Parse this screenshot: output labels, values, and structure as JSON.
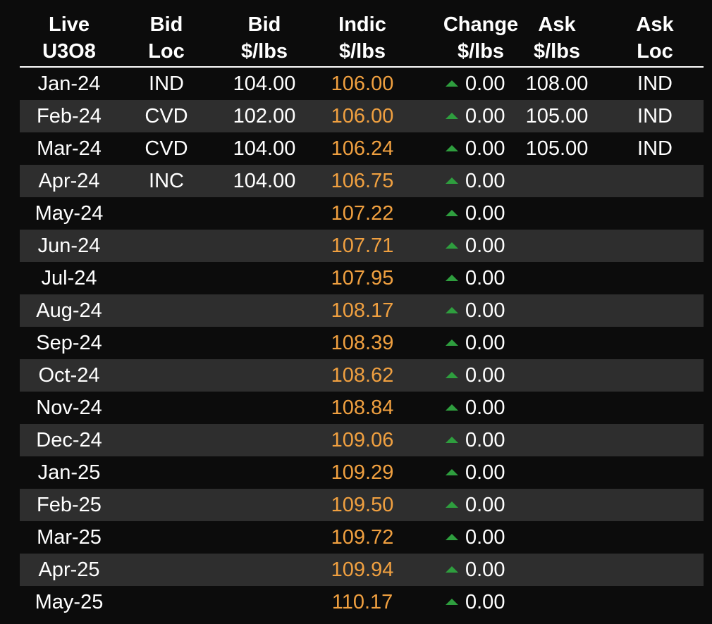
{
  "headers": [
    {
      "line1": "Live",
      "line2": "U3O8"
    },
    {
      "line1": "Bid",
      "line2": "Loc"
    },
    {
      "line1": "Bid",
      "line2": "$/lbs"
    },
    {
      "line1": "Indic",
      "line2": "$/lbs"
    },
    {
      "line1": "Change",
      "line2": "$/lbs"
    },
    {
      "line1": "Ask",
      "line2": "$/lbs"
    },
    {
      "line1": "Ask",
      "line2": "Loc"
    }
  ],
  "colors": {
    "background": "#0c0c0c",
    "row_alt": "#2e2e2e",
    "indic": "#f0a040",
    "up_arrow": "#2e9e3e",
    "text": "#ffffff"
  },
  "change_icon": "up-triangle-icon",
  "rows": [
    {
      "month": "Jan-24",
      "bid_loc": "IND",
      "bid": "104.00",
      "indic": "106.00",
      "change": "0.00",
      "ask": "108.00",
      "ask_loc": "IND"
    },
    {
      "month": "Feb-24",
      "bid_loc": "CVD",
      "bid": "102.00",
      "indic": "106.00",
      "change": "0.00",
      "ask": "105.00",
      "ask_loc": "IND"
    },
    {
      "month": "Mar-24",
      "bid_loc": "CVD",
      "bid": "104.00",
      "indic": "106.24",
      "change": "0.00",
      "ask": "105.00",
      "ask_loc": "IND"
    },
    {
      "month": "Apr-24",
      "bid_loc": "INC",
      "bid": "104.00",
      "indic": "106.75",
      "change": "0.00",
      "ask": "",
      "ask_loc": ""
    },
    {
      "month": "May-24",
      "bid_loc": "",
      "bid": "",
      "indic": "107.22",
      "change": "0.00",
      "ask": "",
      "ask_loc": ""
    },
    {
      "month": "Jun-24",
      "bid_loc": "",
      "bid": "",
      "indic": "107.71",
      "change": "0.00",
      "ask": "",
      "ask_loc": ""
    },
    {
      "month": "Jul-24",
      "bid_loc": "",
      "bid": "",
      "indic": "107.95",
      "change": "0.00",
      "ask": "",
      "ask_loc": ""
    },
    {
      "month": "Aug-24",
      "bid_loc": "",
      "bid": "",
      "indic": "108.17",
      "change": "0.00",
      "ask": "",
      "ask_loc": ""
    },
    {
      "month": "Sep-24",
      "bid_loc": "",
      "bid": "",
      "indic": "108.39",
      "change": "0.00",
      "ask": "",
      "ask_loc": ""
    },
    {
      "month": "Oct-24",
      "bid_loc": "",
      "bid": "",
      "indic": "108.62",
      "change": "0.00",
      "ask": "",
      "ask_loc": ""
    },
    {
      "month": "Nov-24",
      "bid_loc": "",
      "bid": "",
      "indic": "108.84",
      "change": "0.00",
      "ask": "",
      "ask_loc": ""
    },
    {
      "month": "Dec-24",
      "bid_loc": "",
      "bid": "",
      "indic": "109.06",
      "change": "0.00",
      "ask": "",
      "ask_loc": ""
    },
    {
      "month": "Jan-25",
      "bid_loc": "",
      "bid": "",
      "indic": "109.29",
      "change": "0.00",
      "ask": "",
      "ask_loc": ""
    },
    {
      "month": "Feb-25",
      "bid_loc": "",
      "bid": "",
      "indic": "109.50",
      "change": "0.00",
      "ask": "",
      "ask_loc": ""
    },
    {
      "month": "Mar-25",
      "bid_loc": "",
      "bid": "",
      "indic": "109.72",
      "change": "0.00",
      "ask": "",
      "ask_loc": ""
    },
    {
      "month": "Apr-25",
      "bid_loc": "",
      "bid": "",
      "indic": "109.94",
      "change": "0.00",
      "ask": "",
      "ask_loc": ""
    },
    {
      "month": "May-25",
      "bid_loc": "",
      "bid": "",
      "indic": "110.17",
      "change": "0.00",
      "ask": "",
      "ask_loc": ""
    }
  ]
}
